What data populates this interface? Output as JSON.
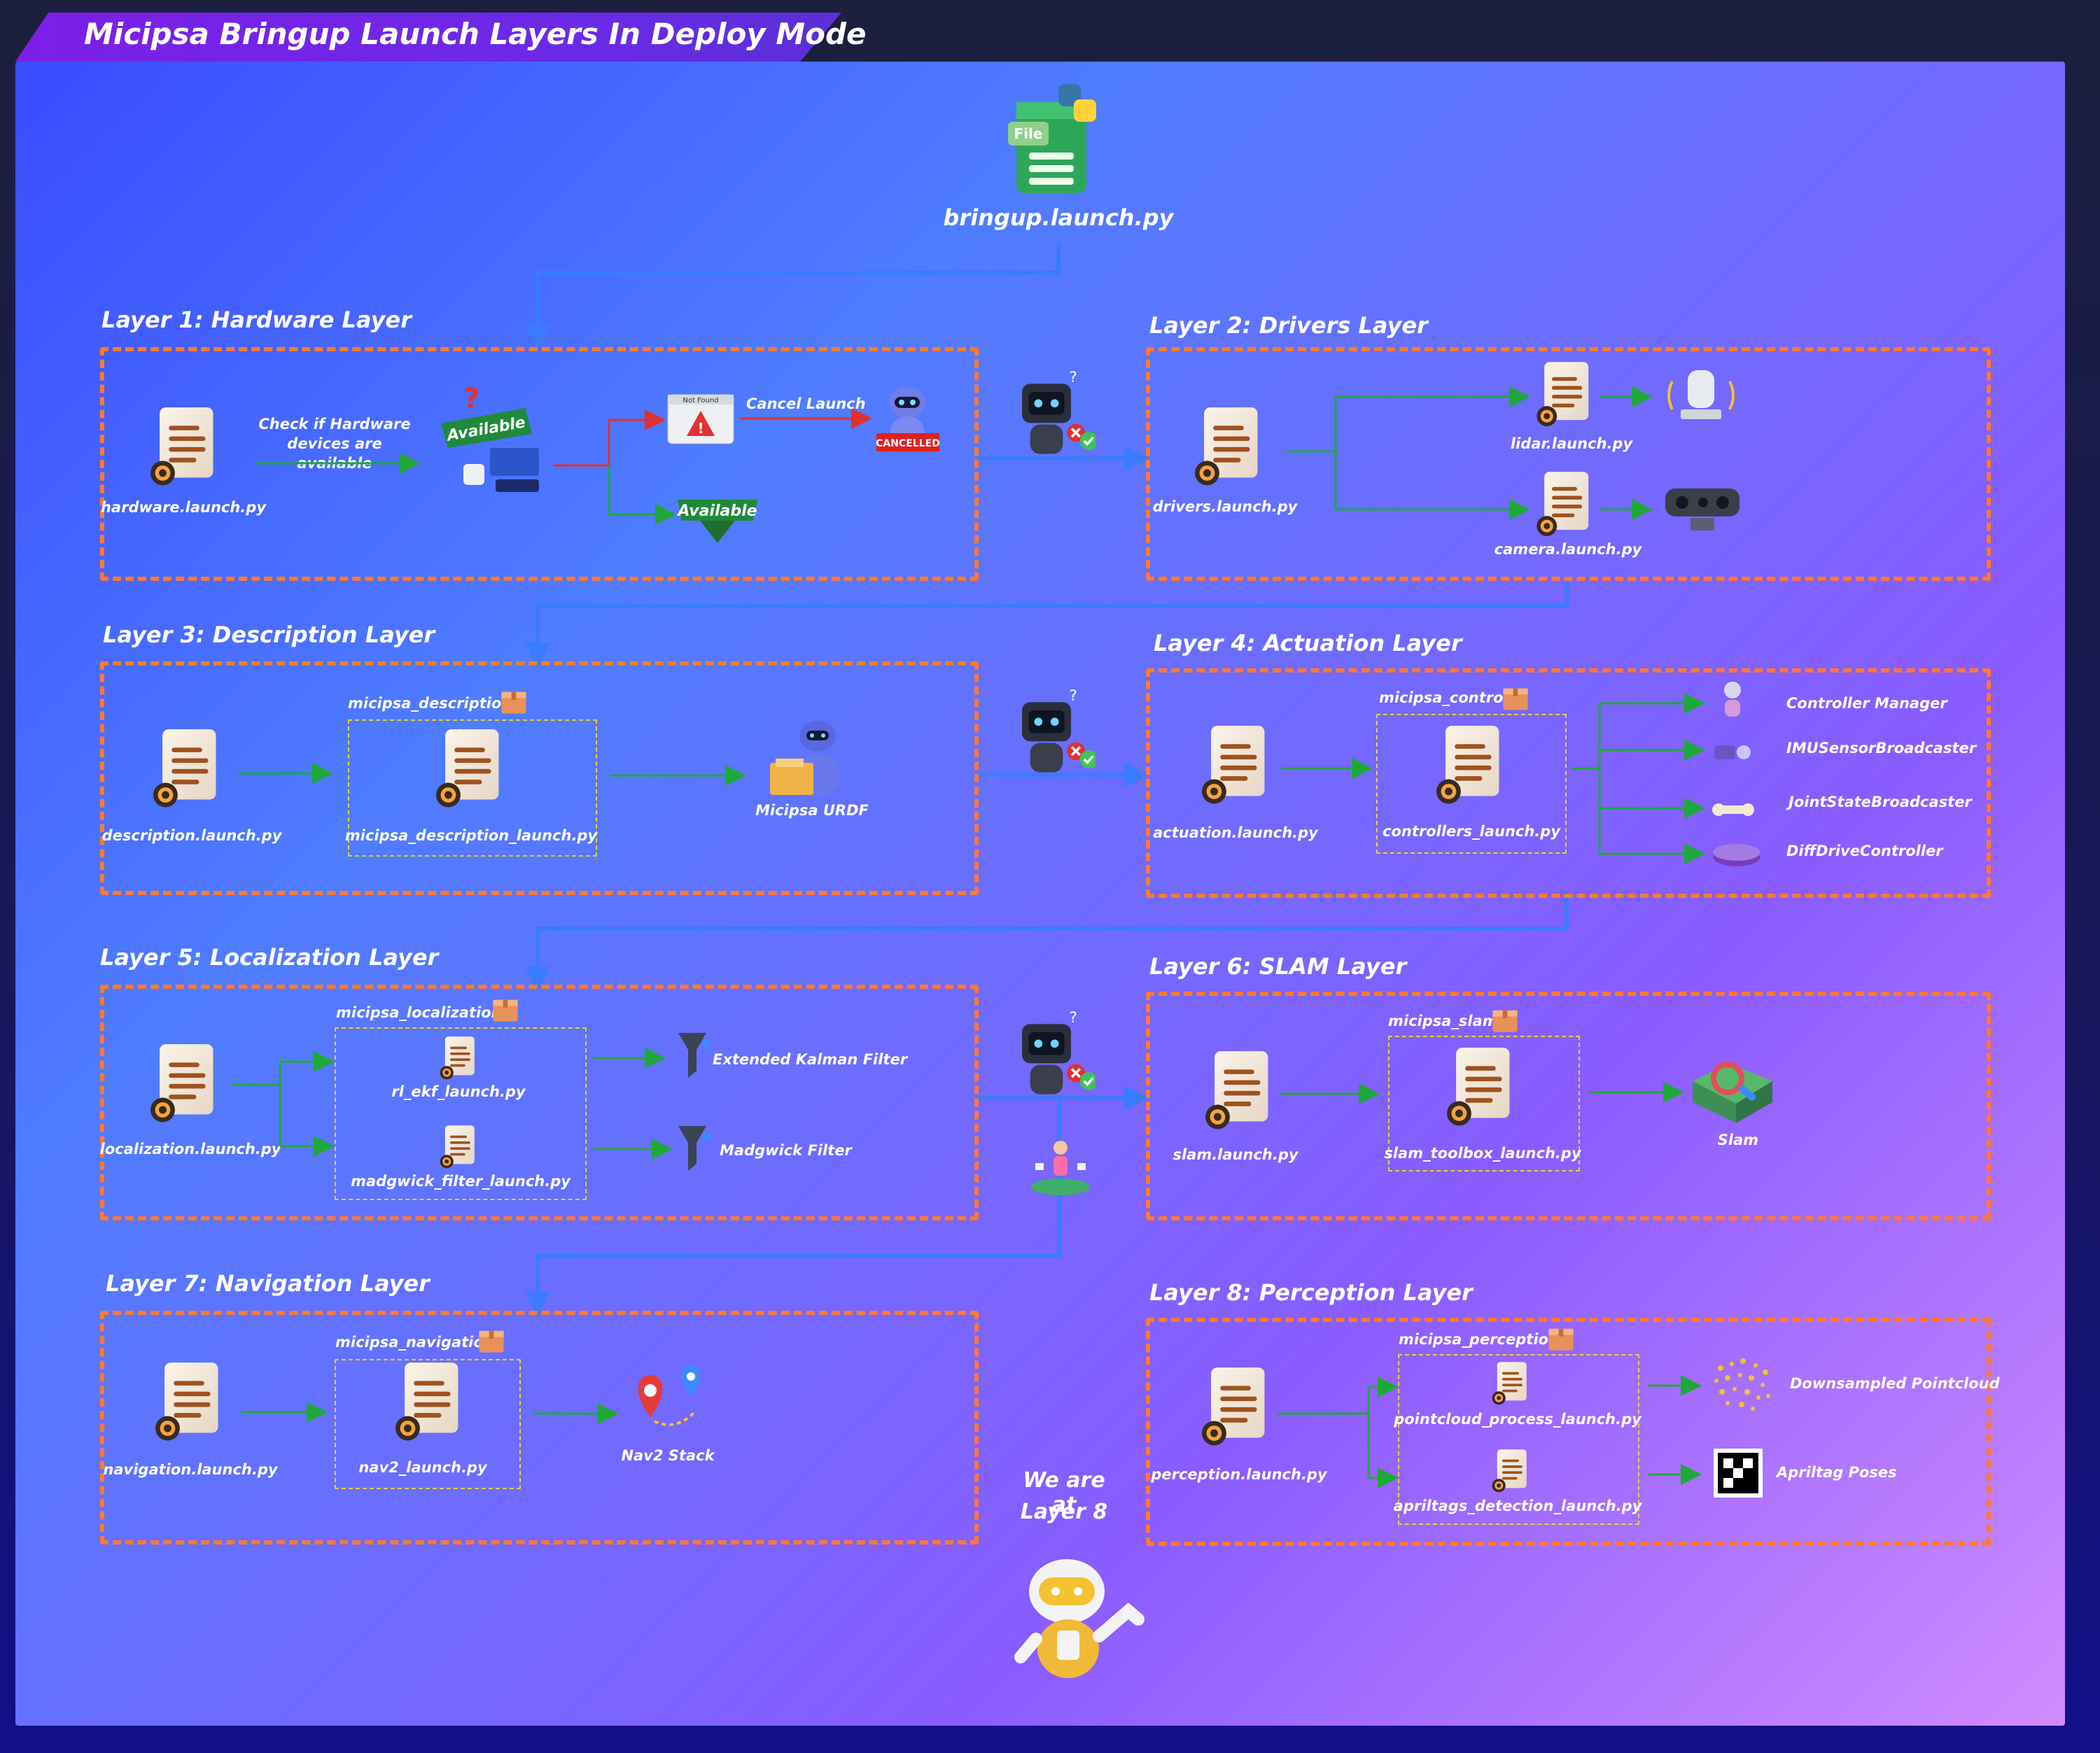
{
  "title": "Micipsa Bringup Launch Layers In Deploy Mode",
  "root": {
    "file": "bringup.launch.py",
    "badge": "File"
  },
  "layer1": {
    "title": "Layer 1: Hardware Layer",
    "file": "hardware.launch.py",
    "check_label": "Check if Hardware devices are available",
    "available": "Available",
    "not_found": "Not Found",
    "cancel_launch": "Cancel Launch",
    "cancelled": "CANCELLED"
  },
  "layer2": {
    "title": "Layer 2: Drivers Layer",
    "file": "drivers.launch.py",
    "lidar": "lidar.launch.py",
    "camera": "camera.launch.py"
  },
  "layer3": {
    "title": "Layer 3: Description Layer",
    "file": "description.launch.py",
    "package": "micipsa_description",
    "pkg_file": "micipsa_description_launch.py",
    "output": "Micipsa URDF"
  },
  "layer4": {
    "title": "Layer 4: Actuation Layer",
    "file": "actuation.launch.py",
    "package": "micipsa_control",
    "pkg_file": "controllers_launch.py",
    "outputs": [
      "Controller Manager",
      "IMUSensorBroadcaster",
      "JointStateBroadcaster",
      "DiffDriveController"
    ]
  },
  "layer5": {
    "title": "Layer 5: Localization Layer",
    "file": "localization.launch.py",
    "package": "micipsa_localization",
    "pkg_files": [
      "rl_ekf_launch.py",
      "madgwick_filter_launch.py"
    ],
    "outputs": [
      "Extended Kalman Filter",
      "Madgwick Filter"
    ]
  },
  "layer6": {
    "title": "Layer 6: SLAM Layer",
    "file": "slam.launch.py",
    "package": "micipsa_slam",
    "pkg_file": "slam_toolbox_launch.py",
    "output": "Slam"
  },
  "layer7": {
    "title": "Layer 7: Navigation Layer",
    "file": "navigation.launch.py",
    "package": "micipsa_navigation",
    "pkg_file": "nav2_launch.py",
    "output": "Nav2 Stack"
  },
  "layer8": {
    "title": "Layer 8: Perception Layer",
    "file": "perception.launch.py",
    "package": "micipsa_perception",
    "pkg_files": [
      "pointcloud_process_launch.py",
      "apriltags_detection_launch.py"
    ],
    "outputs": [
      "Downsampled Pointcloud",
      "Apriltag Poses"
    ]
  },
  "status": {
    "line1": "We are at",
    "line2": "Layer 8"
  },
  "colors": {
    "dash": "#ff7a2e",
    "blue_arrow": "#3b7bff",
    "green_arrow": "#1fa83a",
    "red_arrow": "#e03030",
    "pkg_dash": "#e6d23a"
  }
}
